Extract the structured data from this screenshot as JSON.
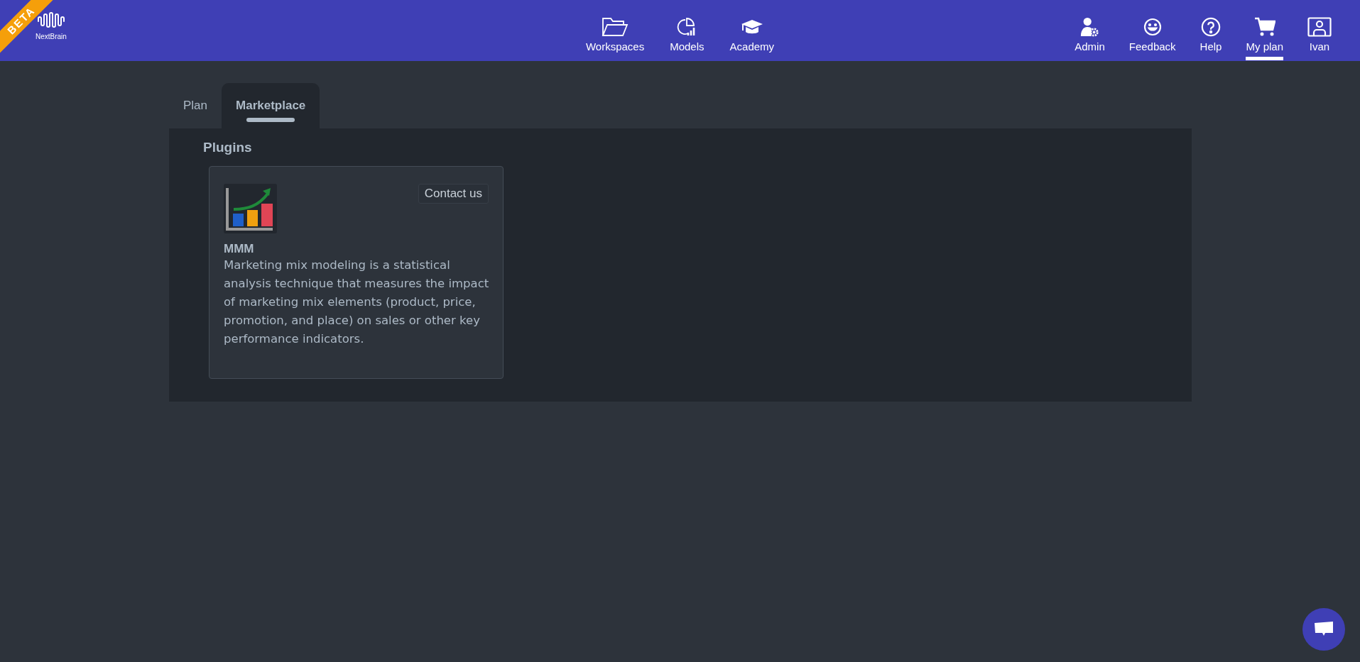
{
  "header": {
    "ribbon": "BETA",
    "logo": "NextBrain",
    "nav_center": [
      {
        "label": "Workspaces",
        "selected": false
      },
      {
        "label": "Models",
        "selected": false
      },
      {
        "label": "Academy",
        "selected": false
      }
    ],
    "nav_right": [
      {
        "label": "Admin",
        "selected": false
      },
      {
        "label": "Feedback",
        "selected": false
      },
      {
        "label": "Help",
        "selected": false
      },
      {
        "label": "My plan",
        "selected": true
      },
      {
        "label": "Ivan",
        "selected": false
      }
    ]
  },
  "tabs": [
    {
      "label": "Plan",
      "selected": false
    },
    {
      "label": "Marketplace",
      "selected": true
    }
  ],
  "section_title": "Plugins",
  "plugins": [
    {
      "name": "MMM",
      "button": "Contact us",
      "description": "Marketing mix modeling is a statistical analysis technique that measures the impact of marketing mix elements (product, price, promotion, and place) on sales or other key performance indicators."
    }
  ]
}
